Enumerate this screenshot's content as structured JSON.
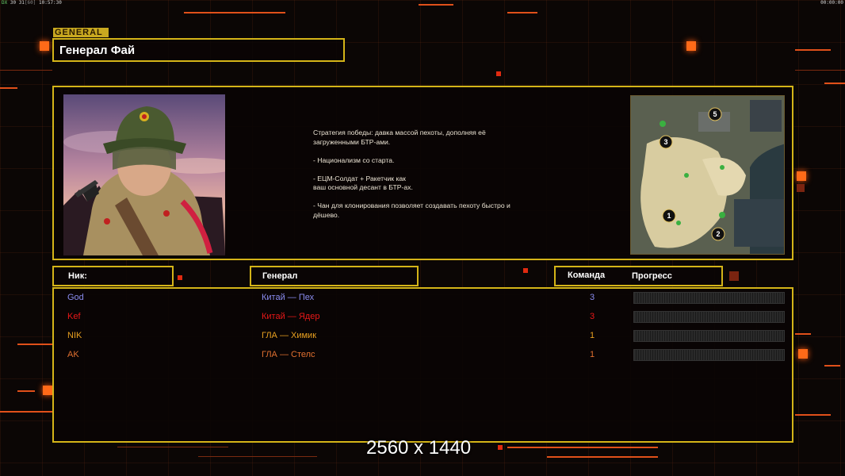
{
  "status_left": {
    "prefix": "DX",
    "fps": "30 31",
    "suffix": "[60]",
    "time": "10:57:30"
  },
  "status_right": "00:00:00",
  "general_tag": "GENERAL",
  "title": "Генерал Фай",
  "description": "Стратегия победы: давка массой пехоты, дополняя её\n загруженными БТР-ами.\n\n- Национализм со старта.\n\n- ЕЦМ-Солдат + Ракетчик как\nваш основной десант в БТР-ах.\n\n- Чан для клонирования позволяет создавать пехоту быстро и\n дёшево.",
  "minimap": {
    "markers": [
      "1",
      "2",
      "3",
      "5"
    ]
  },
  "columns": {
    "nick": "Ник:",
    "general": "Генерал",
    "team": "Команда",
    "progress": "Прогресс"
  },
  "players": [
    {
      "nick": "God",
      "general": "Китай — Пех",
      "team": "3",
      "color": "#8a8cf0",
      "progress": 0
    },
    {
      "nick": "Kef",
      "general": "Китай — Ядер",
      "team": "3",
      "color": "#e81818",
      "progress": 0
    },
    {
      "nick": "NIK",
      "general": "ГЛА — Химик",
      "team": "1",
      "color": "#e8a020",
      "progress": 0
    },
    {
      "nick": "AK",
      "general": "ГЛА — Стелс",
      "team": "1",
      "color": "#e07030",
      "progress": 0
    }
  ],
  "resolution_label": "2560 x 1440",
  "colors": {
    "frame": "#d4b418",
    "accent": "#ff6a18"
  }
}
